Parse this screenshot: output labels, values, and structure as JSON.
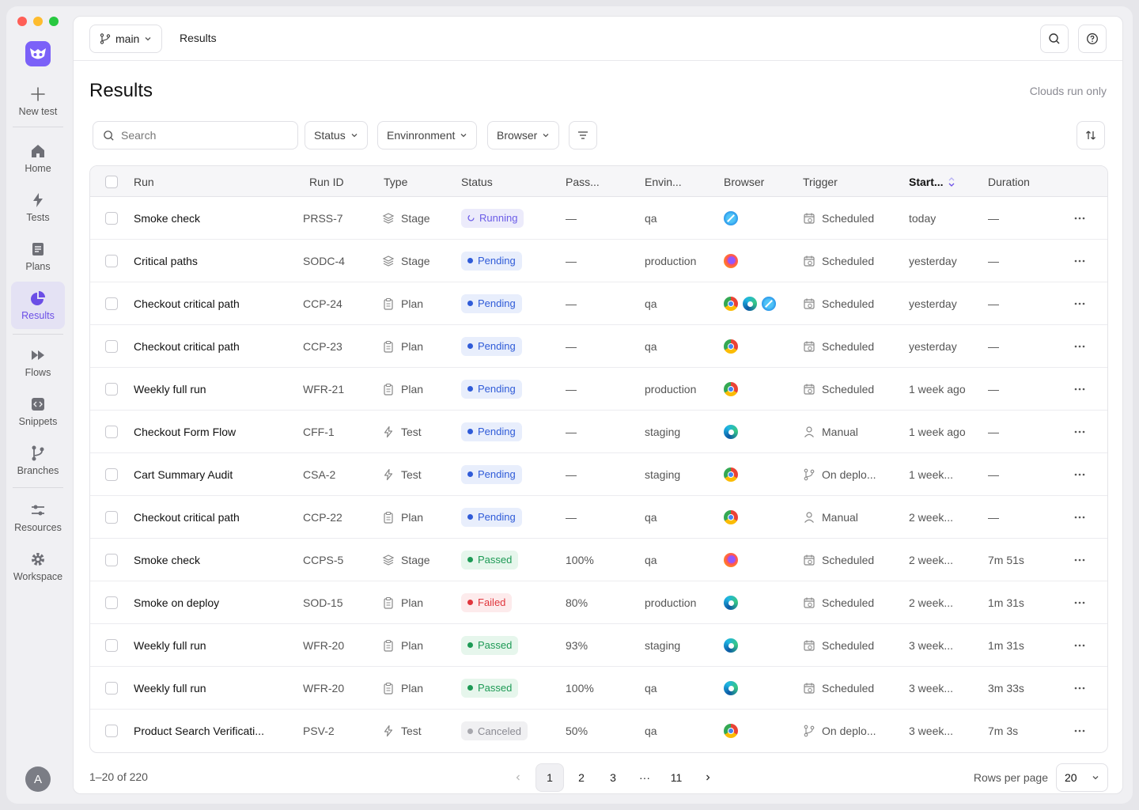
{
  "sidebar": {
    "new_test": "New test",
    "items": [
      {
        "label": "Home",
        "icon": "home-icon"
      },
      {
        "label": "Tests",
        "icon": "bolt-icon"
      },
      {
        "label": "Plans",
        "icon": "document-icon"
      },
      {
        "label": "Results",
        "icon": "pie-chart-icon",
        "active": true
      },
      {
        "label": "Flows",
        "icon": "fast-forward-icon"
      },
      {
        "label": "Snippets",
        "icon": "code-icon"
      },
      {
        "label": "Branches",
        "icon": "branch-icon"
      },
      {
        "label": "Resources",
        "icon": "sliders-icon"
      },
      {
        "label": "Workspace",
        "icon": "gear-icon"
      }
    ],
    "avatar": "A"
  },
  "topbar": {
    "branch": "main",
    "breadcrumb": "Results"
  },
  "page": {
    "title": "Results",
    "cloud_note": "Clouds run only"
  },
  "filters": {
    "search_placeholder": "Search",
    "status": "Status",
    "environment": "Envinronment",
    "browser": "Browser"
  },
  "table": {
    "headers": {
      "run": "Run",
      "run_id": "Run ID",
      "type": "Type",
      "status": "Status",
      "pass": "Pass...",
      "env": "Envin...",
      "browser": "Browser",
      "trigger": "Trigger",
      "started": "Start...",
      "duration": "Duration"
    },
    "rows": [
      {
        "run": "Smoke check",
        "id": "PRSS-7",
        "type": "Stage",
        "status": "Running",
        "pass": "—",
        "env": "qa",
        "browsers": [
          "safari"
        ],
        "trigger": "Scheduled",
        "started": "today",
        "duration": "—"
      },
      {
        "run": "Critical paths",
        "id": "SODC-4",
        "type": "Stage",
        "status": "Pending",
        "pass": "—",
        "env": "production",
        "browsers": [
          "firefox"
        ],
        "trigger": "Scheduled",
        "started": "yesterday",
        "duration": "—"
      },
      {
        "run": "Checkout critical path",
        "id": "CCP-24",
        "type": "Plan",
        "status": "Pending",
        "pass": "—",
        "env": "qa",
        "browsers": [
          "chrome",
          "edge",
          "safari"
        ],
        "trigger": "Scheduled",
        "started": "yesterday",
        "duration": "—"
      },
      {
        "run": "Checkout critical path",
        "id": "CCP-23",
        "type": "Plan",
        "status": "Pending",
        "pass": "—",
        "env": "qa",
        "browsers": [
          "chrome"
        ],
        "trigger": "Scheduled",
        "started": "yesterday",
        "duration": "—"
      },
      {
        "run": "Weekly full run",
        "id": "WFR-21",
        "type": "Plan",
        "status": "Pending",
        "pass": "—",
        "env": "production",
        "browsers": [
          "chrome"
        ],
        "trigger": "Scheduled",
        "started": "1 week ago",
        "duration": "—"
      },
      {
        "run": "Checkout Form Flow",
        "id": "CFF-1",
        "type": "Test",
        "status": "Pending",
        "pass": "—",
        "env": "staging",
        "browsers": [
          "edge"
        ],
        "trigger": "Manual",
        "started": "1 week ago",
        "duration": "—"
      },
      {
        "run": "Cart Summary Audit",
        "id": "CSA-2",
        "type": "Test",
        "status": "Pending",
        "pass": "—",
        "env": "staging",
        "browsers": [
          "chrome"
        ],
        "trigger": "On deplo...",
        "started": "1 week...",
        "duration": "—"
      },
      {
        "run": "Checkout critical path",
        "id": "CCP-22",
        "type": "Plan",
        "status": "Pending",
        "pass": "—",
        "env": "qa",
        "browsers": [
          "chrome"
        ],
        "trigger": "Manual",
        "started": "2 week...",
        "duration": "—"
      },
      {
        "run": "Smoke check",
        "id": "CCPS-5",
        "type": "Stage",
        "status": "Passed",
        "pass": "100%",
        "env": "qa",
        "browsers": [
          "firefox"
        ],
        "trigger": "Scheduled",
        "started": "2 week...",
        "duration": "7m 51s"
      },
      {
        "run": "Smoke on deploy",
        "id": "SOD-15",
        "type": "Plan",
        "status": "Failed",
        "pass": "80%",
        "env": "production",
        "browsers": [
          "edge"
        ],
        "trigger": "Scheduled",
        "started": "2 week...",
        "duration": "1m 31s"
      },
      {
        "run": "Weekly full run",
        "id": "WFR-20",
        "type": "Plan",
        "status": "Passed",
        "pass": "93%",
        "env": "staging",
        "browsers": [
          "edge"
        ],
        "trigger": "Scheduled",
        "started": "3 week...",
        "duration": "1m 31s"
      },
      {
        "run": "Weekly full run",
        "id": "WFR-20",
        "type": "Plan",
        "status": "Passed",
        "pass": "100%",
        "env": "qa",
        "browsers": [
          "edge"
        ],
        "trigger": "Scheduled",
        "started": "3 week...",
        "duration": "3m 33s"
      },
      {
        "run": "Product Search Verificati...",
        "id": "PSV-2",
        "type": "Test",
        "status": "Canceled",
        "pass": "50%",
        "env": "qa",
        "browsers": [
          "chrome"
        ],
        "trigger": "On deplo...",
        "started": "3 week...",
        "duration": "7m 3s"
      }
    ]
  },
  "footer": {
    "count": "1–20 of 220",
    "pages": [
      "1",
      "2",
      "3",
      "···",
      "11"
    ],
    "current_page": "1",
    "rows_per_page_label": "Rows per page",
    "rows_per_page": "20"
  },
  "colors": {
    "accent": "#7b61f8",
    "running": "#6b5ce7",
    "pending": "#2f5bd8",
    "passed": "#1d9a55",
    "failed": "#e0363d"
  }
}
